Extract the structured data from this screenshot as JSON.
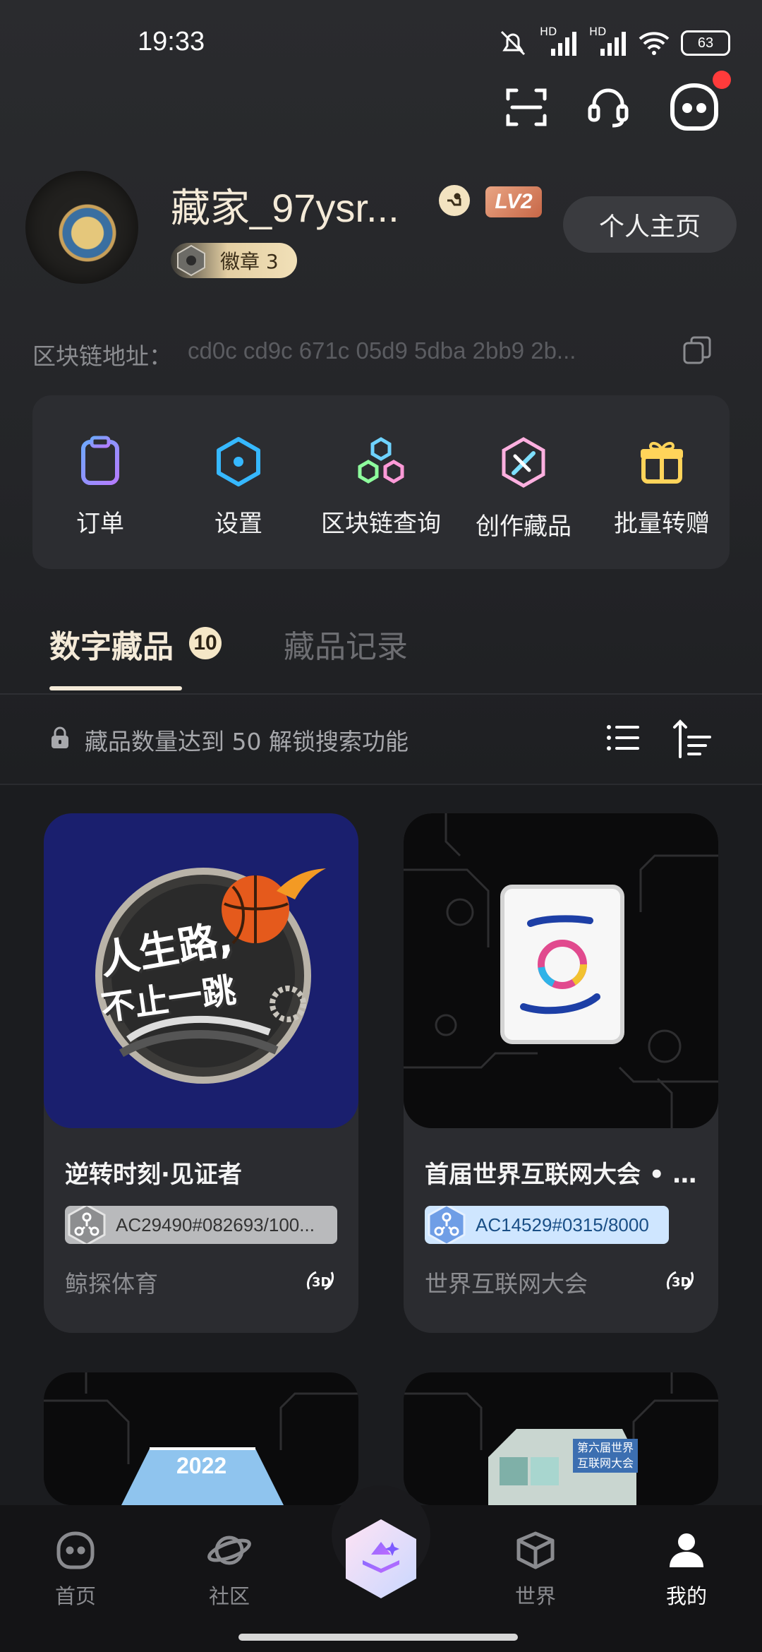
{
  "status_bar": {
    "time": "19:33",
    "battery": "63",
    "network_labels": [
      "HD",
      "HD"
    ]
  },
  "profile": {
    "username": "藏家_97ysr...",
    "level": "LV2",
    "medal_label": "徽章 3",
    "home_button": "个人主页",
    "chain_label": "区块链地址：",
    "chain_address": "cd0c cd9c 671c 05d9 5dba 2bb9 2b..."
  },
  "menu": {
    "items": [
      {
        "label": "订单",
        "icon": "order-icon"
      },
      {
        "label": "设置",
        "icon": "settings-icon"
      },
      {
        "label": "区块链查询",
        "icon": "blockchain-icon"
      },
      {
        "label": "创作藏品",
        "icon": "create-icon"
      },
      {
        "label": "批量转赠",
        "icon": "gift-icon"
      }
    ]
  },
  "tabs": {
    "active": "数字藏品",
    "active_count": "10",
    "other": "藏品记录"
  },
  "search_hint": "藏品数量达到 50 解锁搜索功能",
  "collectibles": [
    {
      "title": "逆转时刻·见证者",
      "serial": "AC29490#082693/100...",
      "issuer": "鲸探体育",
      "image_text": [
        "人生路,",
        "不止一跳"
      ],
      "serial_style": "silver"
    },
    {
      "title": "首届世界互联网大会 • ...",
      "serial": "AC14529#0315/8000",
      "issuer": "世界互联网大会",
      "serial_style": "blue"
    },
    {
      "image_text": "2022"
    },
    {
      "image_text": [
        "第六届世界",
        "互联网大会"
      ]
    }
  ],
  "bottom_nav": [
    {
      "label": "首页",
      "icon": "home-icon"
    },
    {
      "label": "社区",
      "icon": "planet-icon"
    },
    {
      "label": "世界",
      "icon": "cube-icon"
    },
    {
      "label": "我的",
      "icon": "user-icon",
      "active": true
    }
  ],
  "colors": {
    "background": "#1c1d20",
    "accent_gold": "#f4ead8",
    "notification_red": "#ff3b3b",
    "serial_blue": "#cfe6ff"
  }
}
